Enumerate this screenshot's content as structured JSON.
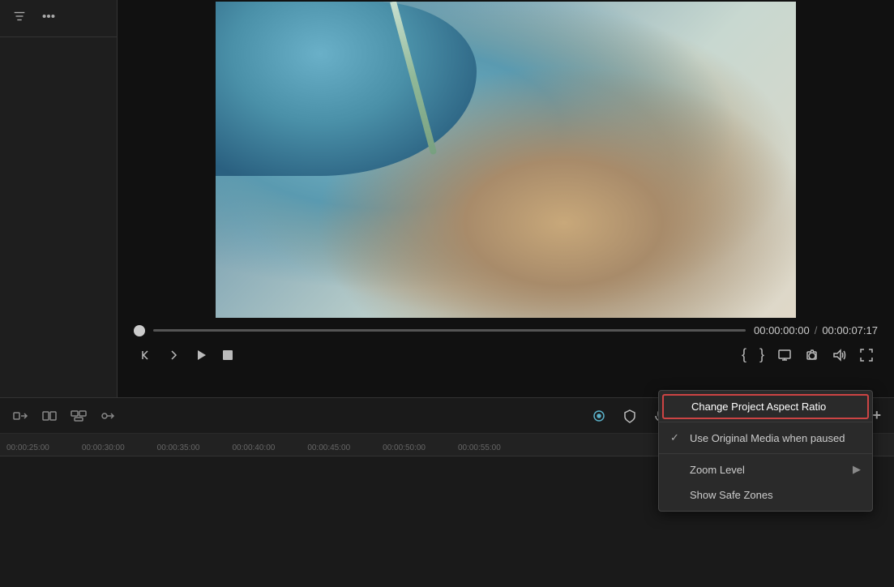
{
  "leftPanel": {
    "filterIcon": "≡",
    "moreIcon": "···"
  },
  "videoPreview": {
    "currentTime": "00:00:00:00",
    "totalTime": "00:00:07:17",
    "separator": "/"
  },
  "playbackControls": {
    "stepBack": "⏮",
    "stepForward": "⏭",
    "play": "▶",
    "stop": "⏹",
    "markIn": "{",
    "markOut": "}",
    "camera": "📷",
    "audio": "🔊",
    "fullscreen": "⤢"
  },
  "timelineToolbar": {
    "icon1": "⇄",
    "icon2": "⊞",
    "icon3": "◫",
    "icon4": "⌥",
    "zoomIn": "+",
    "zoomOut": "−",
    "zoomBar": "▬"
  },
  "timelineRuler": {
    "marks": [
      "00:00:25:00",
      "00:00:30:00",
      "00:00:35:00",
      "00:00:40:00",
      "00:00:45:00",
      "00:00:50:00",
      "00:00:55:00"
    ]
  },
  "contextMenu": {
    "items": [
      {
        "id": "change-aspect-ratio",
        "label": "Change Project Aspect Ratio",
        "check": "",
        "hasArrow": false,
        "highlighted": true
      },
      {
        "id": "use-original-media",
        "label": "Use Original Media when paused",
        "check": "✓",
        "hasArrow": false,
        "highlighted": false
      },
      {
        "id": "zoom-level",
        "label": "Zoom Level",
        "check": "",
        "hasArrow": true,
        "highlighted": false
      },
      {
        "id": "show-safe-zones",
        "label": "Show Safe Zones",
        "check": "",
        "hasArrow": false,
        "highlighted": false
      }
    ]
  }
}
